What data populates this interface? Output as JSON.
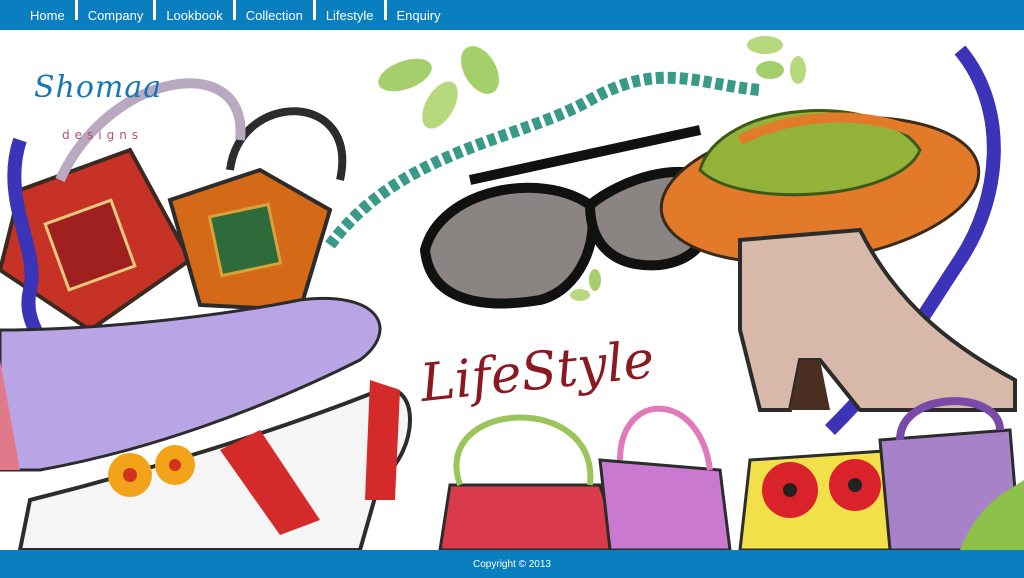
{
  "nav": {
    "items": [
      {
        "label": "Home"
      },
      {
        "label": "Company"
      },
      {
        "label": "Lookbook"
      },
      {
        "label": "Collection"
      },
      {
        "label": "Lifestyle"
      },
      {
        "label": "Enquiry"
      }
    ]
  },
  "logo": {
    "script_text": "Shomaa",
    "sub_text": "designs"
  },
  "hero": {
    "title": "LifeStyle"
  },
  "footer": {
    "copyright": "Copyright © 2013"
  },
  "colors": {
    "brand_blue": "#0a7fc0",
    "title_red": "#8a1a22"
  }
}
